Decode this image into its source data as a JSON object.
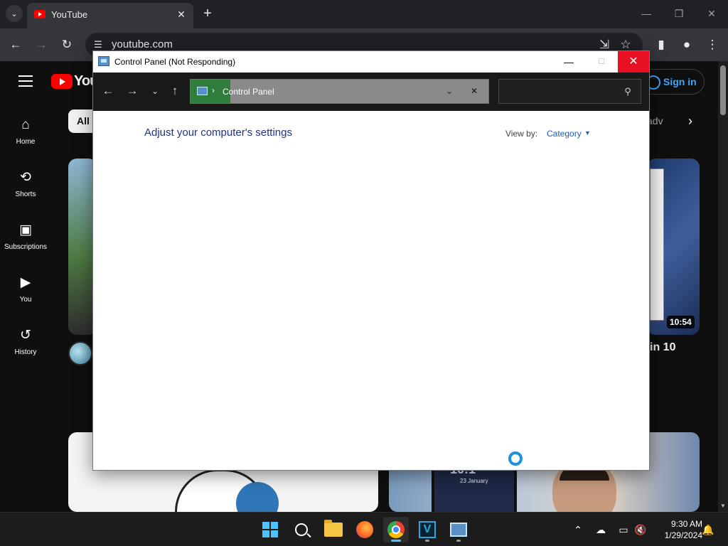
{
  "browser": {
    "tab_title": "YouTube",
    "tab_close": "✕",
    "new_tab": "+",
    "tab_list_icon": "⌄",
    "url": "youtube.com",
    "minimize": "—",
    "maximize": "❐",
    "close": "✕"
  },
  "youtube": {
    "logo_text": "You",
    "chip_all": "All",
    "chip_faded": "adv",
    "sign_in": "Sign in",
    "nav": [
      {
        "label": "Home",
        "icon": "⌂"
      },
      {
        "label": "Shorts",
        "icon": "⟲"
      },
      {
        "label": "Subscriptions",
        "icon": "▣"
      },
      {
        "label": "You",
        "icon": "▶"
      },
      {
        "label": "History",
        "icon": "↺"
      }
    ],
    "video_duration": "10:54",
    "video_title_fragment": "in 10",
    "phone_time": "10:1",
    "phone_date": "23 January"
  },
  "control_panel": {
    "window_title": "Control Panel (Not Responding)",
    "address_separator": "›",
    "address_text": "Control Panel",
    "heading": "Adjust your computer's settings",
    "view_by_label": "View by:",
    "view_by_value": "Category",
    "search_placeholder": ""
  },
  "taskbar": {
    "time": "9:30 AM",
    "date": "1/29/2024"
  },
  "colors": {
    "cp_close_bg": "#e81123",
    "cp_heading": "#1e3287",
    "cp_link": "#1a5fb4",
    "yt_red": "#ff0000",
    "yt_blue": "#3ea6ff",
    "spinner": "#1e90e0"
  }
}
